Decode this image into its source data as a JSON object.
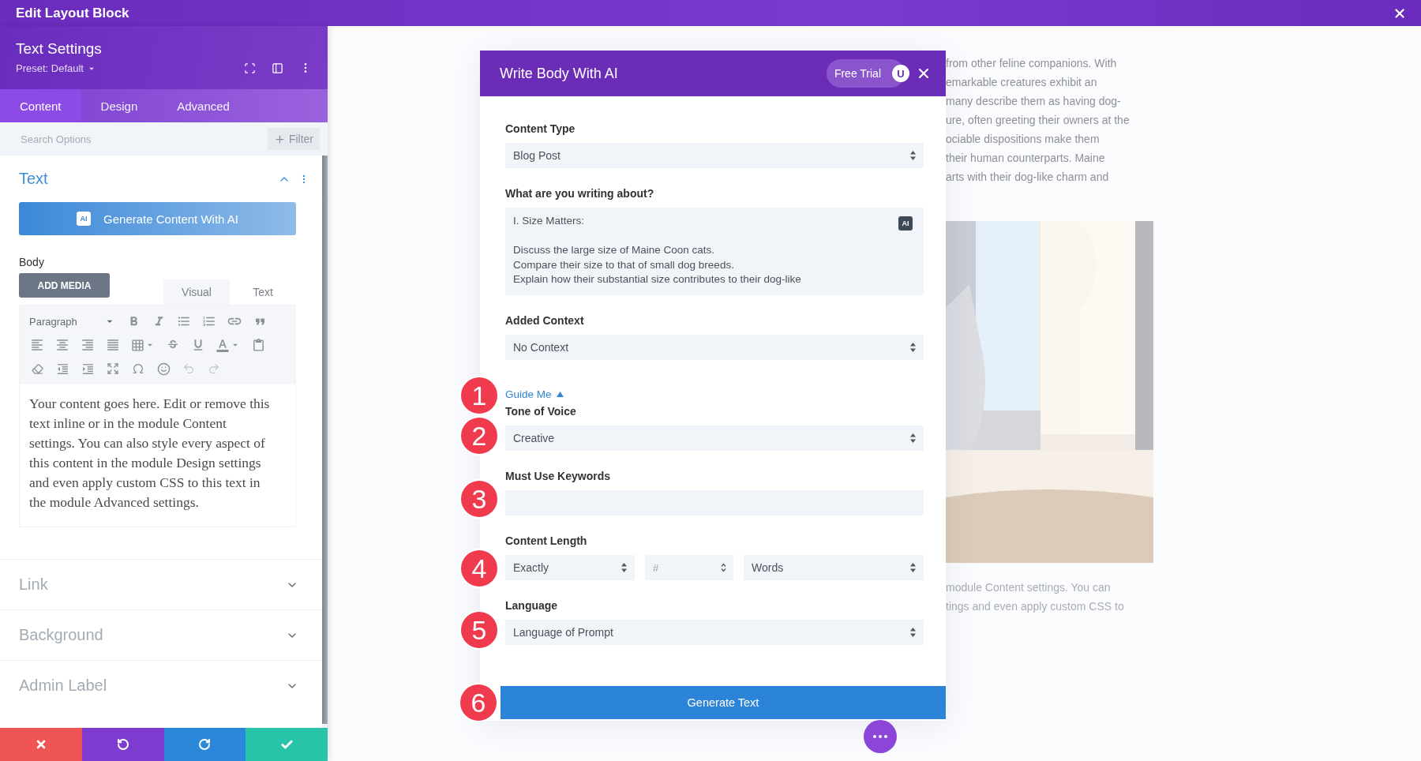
{
  "top_bar": {
    "title": "Edit Layout Block"
  },
  "settings_panel": {
    "title": "Text Settings",
    "preset": "Preset: Default",
    "tabs": [
      {
        "label": "Content",
        "selected": true
      },
      {
        "label": "Design",
        "selected": false
      },
      {
        "label": "Advanced",
        "selected": false
      }
    ],
    "search": {
      "placeholder": "Search Options"
    },
    "filter_button": "Filter",
    "text_section": {
      "title": "Text",
      "expanded": true,
      "generate_button": "Generate Content With AI",
      "ai_badge": "AI",
      "body_label": "Body",
      "add_media_button": "ADD MEDIA",
      "editor_tabs": [
        {
          "label": "Visual",
          "selected": true
        },
        {
          "label": "Text",
          "selected": false
        }
      ],
      "format_select": "Paragraph",
      "content": "Your content goes here. Edit or remove this text inline or in the module Content settings. You can also style every aspect of this content in the module Design settings and even apply custom CSS to this text in the module Advanced settings."
    },
    "sections": [
      {
        "title": "Link",
        "expanded": false
      },
      {
        "title": "Background",
        "expanded": false
      },
      {
        "title": "Admin Label",
        "expanded": false
      }
    ]
  },
  "dialog": {
    "title": "Write Body With AI",
    "trial_label": "Free Trial",
    "avatar_letter": "U",
    "fields": [
      {
        "kind": "select",
        "label": "Content Type",
        "value": "Blog Post"
      },
      {
        "kind": "textarea",
        "label": "What are you writing about?",
        "value": "I. Size Matters:\n\nDiscuss the large size of Maine Coon cats.\nCompare their size to that of small dog breeds.\nExplain how their substantial size contributes to their dog-like",
        "ai_badge": "AI"
      },
      {
        "kind": "select",
        "label": "Added Context",
        "value": "No Context"
      },
      {
        "kind": "toggle",
        "label": "Guide Me",
        "expanded": true,
        "marker": "1"
      },
      {
        "kind": "select",
        "label": "Tone of Voice",
        "value": "Creative",
        "marker": "2"
      },
      {
        "kind": "input",
        "label": "Must Use Keywords",
        "marker": "3"
      },
      {
        "kind": "length",
        "label": "Content Length",
        "mode": "Exactly",
        "number_placeholder": "#",
        "unit": "Words",
        "marker": "4"
      },
      {
        "kind": "select",
        "label": "Language",
        "value": "Language of Prompt",
        "marker": "5"
      }
    ],
    "submit": {
      "label": "Generate Text",
      "marker": "6"
    }
  },
  "page_preview": {
    "paragraph_lines": [
      "from other feline companions. With",
      "emarkable creatures exhibit an",
      "many describe them as having dog-",
      "ure, often greeting their owners at the",
      "ociable dispositions make them",
      "their human counterparts. Maine",
      "arts with their dog-like charm and"
    ],
    "caption_lines": [
      "module Content settings. You can",
      "tings and even apply custom CSS to"
    ]
  }
}
